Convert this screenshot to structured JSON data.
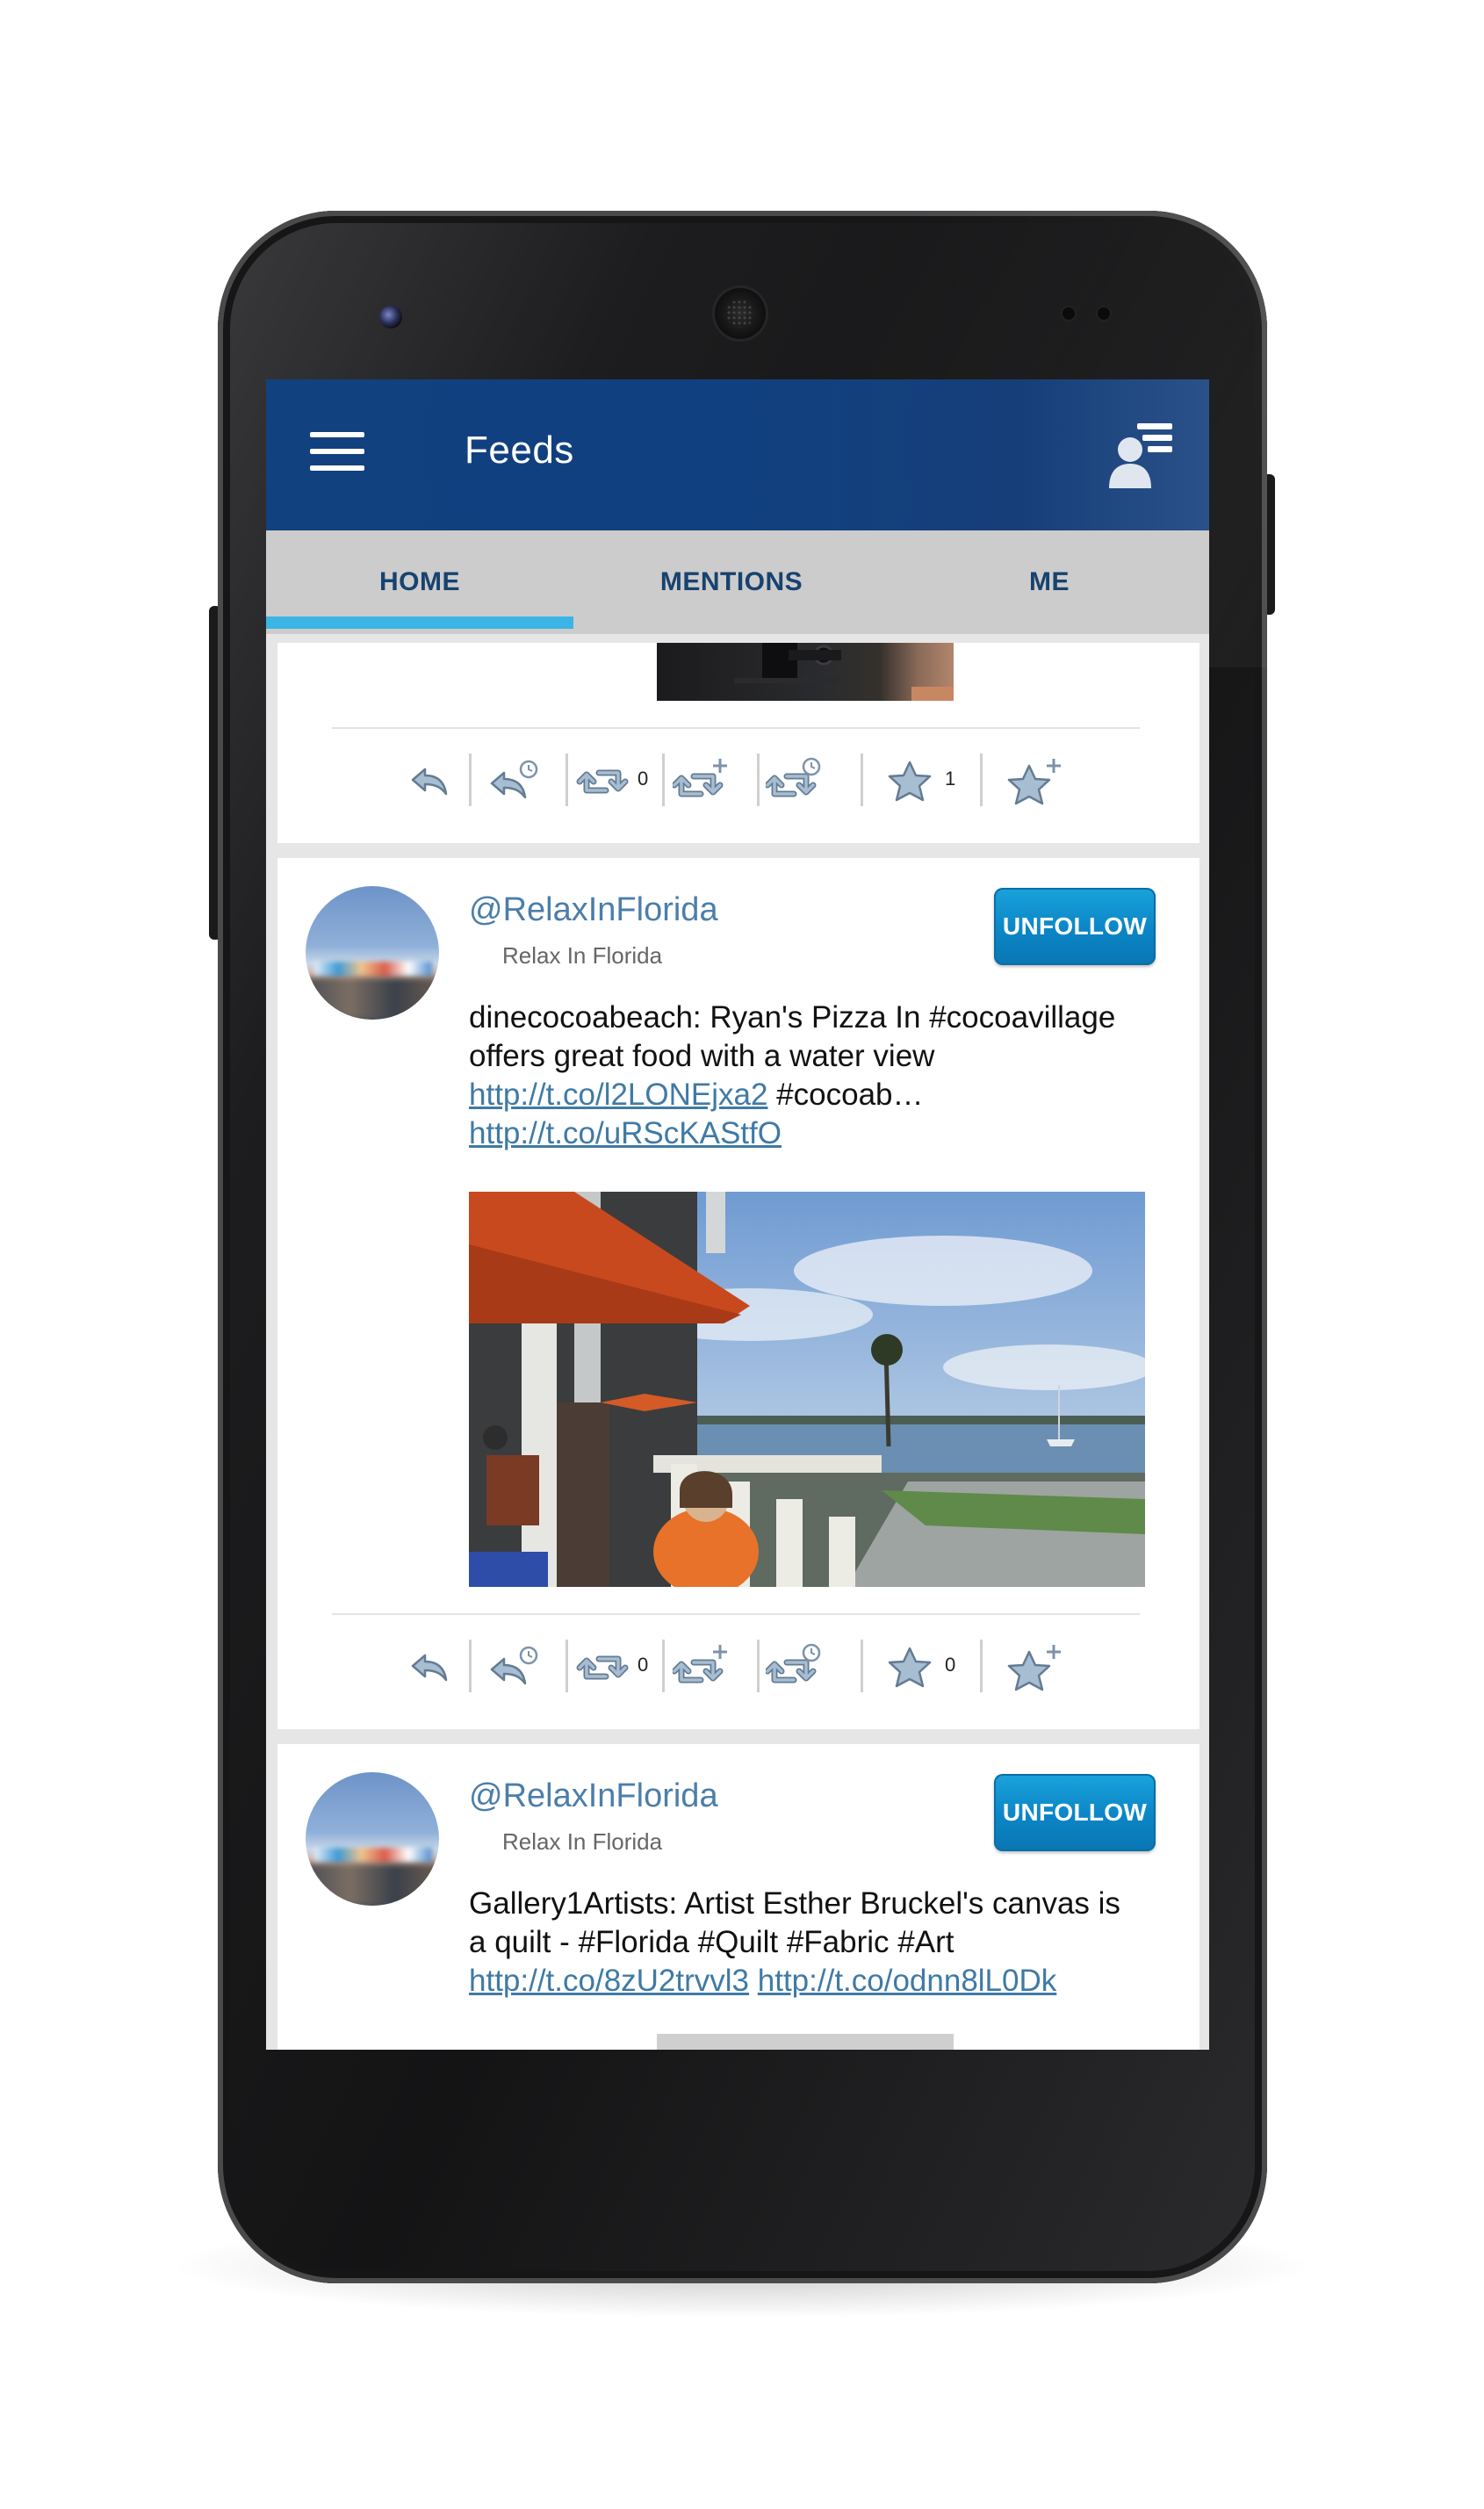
{
  "app_bar": {
    "title": "Feeds",
    "menu_icon": "hamburger-menu-icon",
    "profile_icon": "user-list-icon",
    "background": "#11417f"
  },
  "tabs": [
    {
      "label": "HOME",
      "active": true
    },
    {
      "label": "MENTIONS",
      "active": false
    },
    {
      "label": "ME",
      "active": false
    }
  ],
  "accent_color": "#3cb4e5",
  "top_card": {
    "retweet_count": "0",
    "favorite_count": "1"
  },
  "tweets": [
    {
      "handle": "@RelaxInFlorida",
      "display_name": "Relax In Florida",
      "follow_label": "UNFOLLOW",
      "text_1": "dinecocoabeach: Ryan's Pizza In #cocoavillage offers great food with a water view ",
      "link_1": "http://t.co/l2LONEjxa2",
      "text_2": " #cocoab… ",
      "link_2": "http://t.co/uRScKAStfO",
      "photo_description_icon": "photo",
      "retweet_count": "0",
      "favorite_count": "0"
    },
    {
      "handle": "@RelaxInFlorida",
      "display_name": "Relax In Florida",
      "follow_label": "UNFOLLOW",
      "text_1": "Gallery1Artists: Artist Esther Bruckel's canvas is a quilt - #Florida #Quilt #Fabric #Art ",
      "link_1": "http://t.co/8zU2trvvl3",
      "text_2": " ",
      "link_2": "http://t.co/odnn8lL0Dk"
    }
  ],
  "action_icons": [
    "reply-icon",
    "scheduled-reply-icon",
    "retweet-icon",
    "quote-retweet-icon",
    "scheduled-retweet-icon",
    "favorite-icon",
    "add-favorite-icon"
  ]
}
